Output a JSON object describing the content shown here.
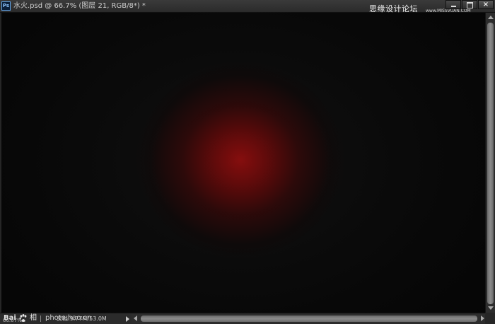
{
  "titlebar": {
    "app_badge": "Ps",
    "title": "水火.psd @ 66.7% (图层 21, RGB/8*) *",
    "watermark": "思缘设计论坛",
    "watermark_sub": "www.MISSVUAN.COM",
    "controls": {
      "minimize": "minimize",
      "maximize": "maximize",
      "close_glyph": "×"
    }
  },
  "canvas": {
    "background": "#050505",
    "glow_color": "#860e0e"
  },
  "statusbar": {
    "baidu_text": "Bai",
    "baidu_suffix": "相",
    "zoom": "66.67%",
    "album_text": "photo.hao.cn",
    "doc_size": "文档:9.77M/53.0M"
  },
  "icons": {
    "app": "photoshop-icon",
    "paw": "baidu-paw-icon"
  }
}
